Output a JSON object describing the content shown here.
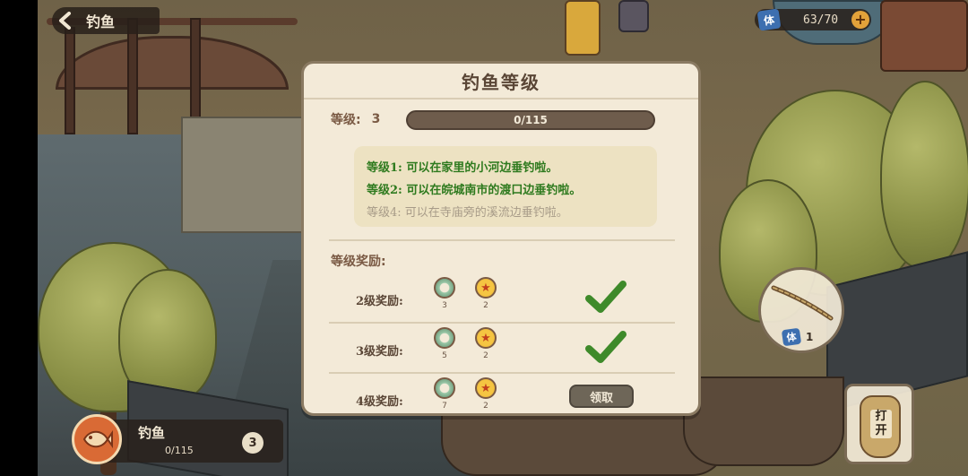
{
  "header": {
    "back_title": "钓鱼"
  },
  "stamina": {
    "icon": "体",
    "value": "63/70",
    "plus": "+"
  },
  "modal": {
    "title": "钓鱼等级",
    "level_label": "等级:",
    "level_value": "3",
    "xp_text": "0/115",
    "xp_progress": 0,
    "descriptions": [
      {
        "text": "等级1: 可以在家里的小河边垂钓啦。",
        "unlocked": true
      },
      {
        "text": "等级2: 可以在皖城南市的渡口边垂钓啦。",
        "unlocked": true
      },
      {
        "text": "等级4: 可以在寺庙旁的溪流边垂钓啦。",
        "unlocked": false
      }
    ],
    "rewards_title": "等级奖励:",
    "rewards": [
      {
        "label": "2级奖励:",
        "ring_count": "3",
        "star_count": "2",
        "status": "claimed"
      },
      {
        "label": "3级奖励:",
        "ring_count": "5",
        "star_count": "2",
        "status": "claimed"
      },
      {
        "label": "4级奖励:",
        "ring_count": "7",
        "star_count": "2",
        "status": "claim",
        "button_label": "领取"
      }
    ]
  },
  "fishing": {
    "name": "钓鱼",
    "xp": "0/115",
    "level": "3"
  },
  "rod": {
    "cost_icon": "体",
    "cost_value": "1"
  },
  "bag": {
    "label": "打开"
  },
  "colors": {
    "unlocked_text": "#2e7a1e",
    "locked_text": "#a79b88",
    "check": "#3e8a2a"
  }
}
